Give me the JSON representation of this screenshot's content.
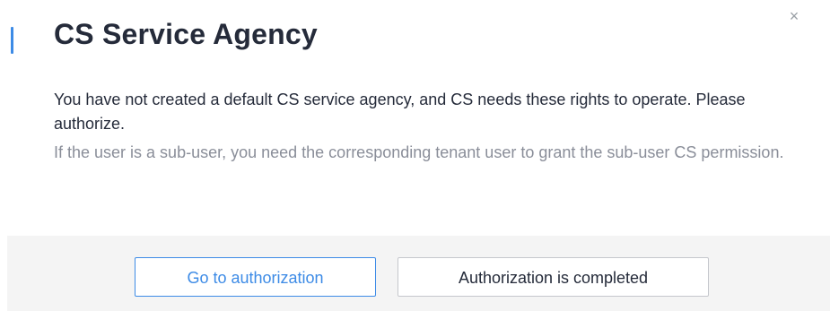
{
  "dialog": {
    "title": "CS Service Agency",
    "close_icon": "×",
    "message_primary": "You have not created a default CS service agency, and CS needs these rights to operate. Please authorize.",
    "message_secondary": "If the user is a sub-user, you need the corresponding tenant user to grant the sub-user CS permission."
  },
  "footer": {
    "go_to_authorization_label": "Go to authorization",
    "authorization_completed_label": "Authorization is completed"
  },
  "colors": {
    "accent": "#3d8be6",
    "title_text": "#252b3a",
    "secondary_text": "#8a8e99",
    "footer_background": "#f4f4f4"
  },
  "icons": {
    "close": "close-icon"
  }
}
